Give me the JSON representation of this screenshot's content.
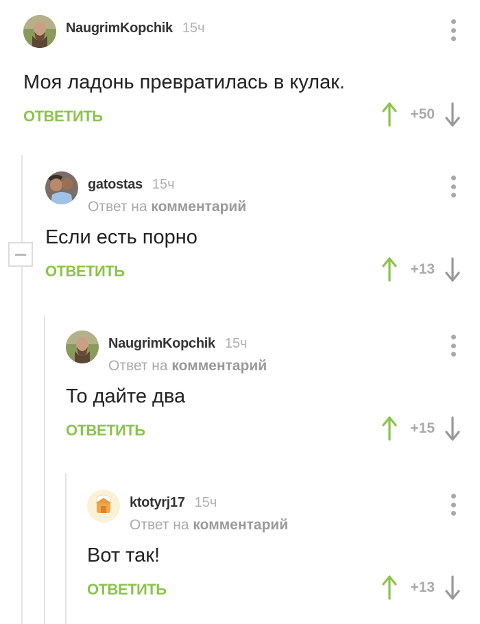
{
  "accent_color": "#8bc34a",
  "menu_icon": "more-vertical-icon",
  "comments": [
    {
      "username": "NaugrimKopchik",
      "time": "15ч",
      "reply_prefix": "",
      "reply_target": "",
      "text": "Моя ладонь превратилась в кулак.",
      "reply_label": "ОТВЕТИТЬ",
      "score": "+50"
    },
    {
      "username": "gatostas",
      "time": "15ч",
      "reply_prefix": "Ответ на ",
      "reply_target": "комментарий",
      "text": "Если есть порно",
      "reply_label": "ОТВЕТИТЬ",
      "score": "+13"
    },
    {
      "username": "NaugrimKopchik",
      "time": "15ч",
      "reply_prefix": "Ответ на ",
      "reply_target": "комментарий",
      "text": "То дайте два",
      "reply_label": "ОТВЕТИТЬ",
      "score": "+15"
    },
    {
      "username": "ktotyrj17",
      "time": "15ч",
      "reply_prefix": "Ответ на ",
      "reply_target": "комментарий",
      "text": "Вот так!",
      "reply_label": "ОТВЕТИТЬ",
      "score": "+13"
    }
  ]
}
